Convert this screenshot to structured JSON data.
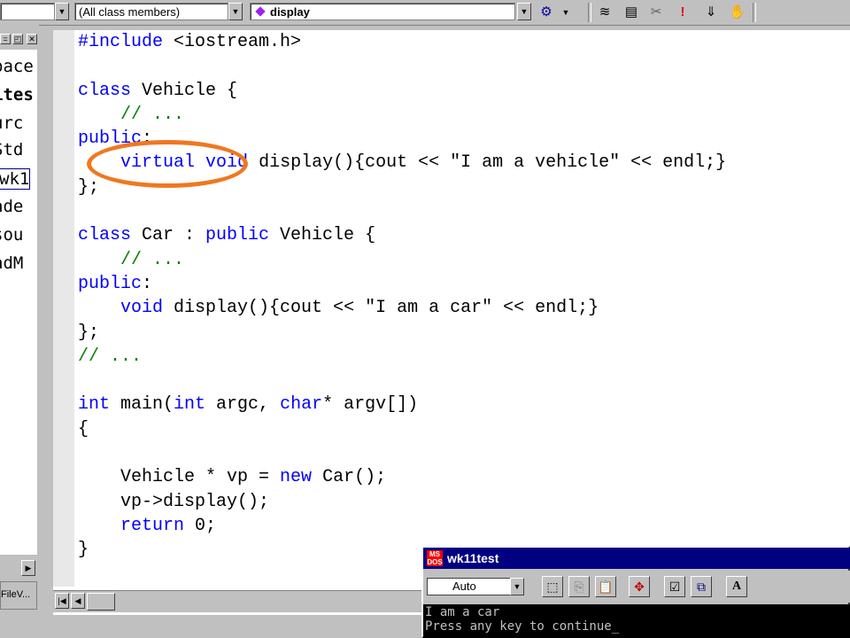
{
  "toolbar": {
    "scope_combo": "",
    "members_combo": "(All class members)",
    "function_combo": "display",
    "icons": [
      "wizard-action-icon",
      "workspace-icon",
      "output-icon",
      "build-icon",
      "execute-icon",
      "insert-icon",
      "hand-icon"
    ]
  },
  "workspace": {
    "tree_lines": [
      "pace",
      "ites",
      "urc",
      "Std",
      "wk1",
      "ade",
      "sou",
      "adM"
    ],
    "tab_label": "FileV..."
  },
  "editor": {
    "lines": [
      "#include <iostream.h>",
      "",
      "class Vehicle {",
      "    // ...",
      "public:",
      "    virtual void display(){cout << \"I am a vehicle\" << endl;}",
      "};",
      "",
      "class Car : public Vehicle {",
      "    // ...",
      "public:",
      "    void display(){cout << \"I am a car\" << endl;}",
      "};",
      "// ...",
      "",
      "int main(int argc, char* argv[])",
      "{",
      "",
      "    Vehicle * vp = new Car();",
      "    vp->display();",
      "    return 0;",
      "}"
    ]
  },
  "console": {
    "title": "wk11test",
    "font_combo": "Auto",
    "output_lines": [
      "I am a car",
      "Press any key to continue_"
    ]
  },
  "colors": {
    "keyword": "#0000ff",
    "comment": "#008000",
    "annotation": "#f07820",
    "titlebar": "#000080"
  }
}
